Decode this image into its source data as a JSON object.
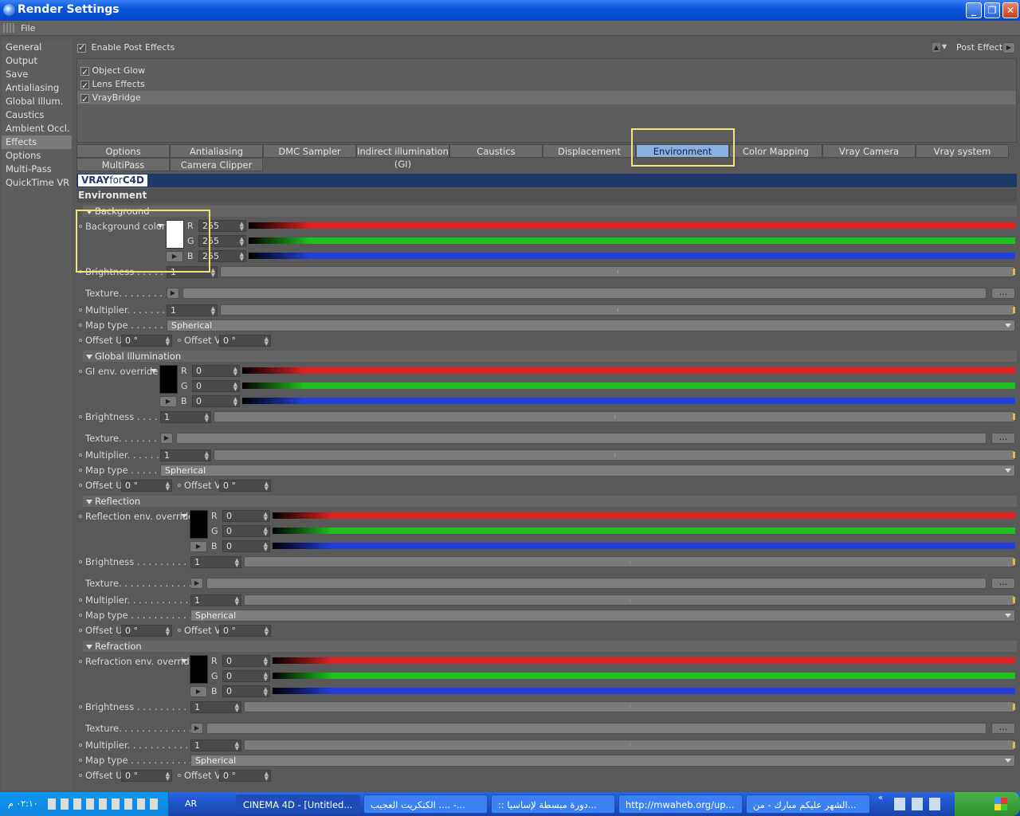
{
  "window": {
    "title": "Render Settings",
    "min": "_",
    "max": "❐",
    "close": "✕"
  },
  "menu": {
    "file": "File"
  },
  "sidebar": [
    {
      "label": "General",
      "active": false
    },
    {
      "label": "Output",
      "active": false
    },
    {
      "label": "Save",
      "active": false
    },
    {
      "label": "Antialiasing",
      "active": false
    },
    {
      "label": "Global Illum.",
      "active": false
    },
    {
      "label": "Caustics",
      "active": false
    },
    {
      "label": "Ambient Occl.",
      "active": false
    },
    {
      "label": "Effects",
      "active": true
    },
    {
      "label": "Options",
      "active": false
    },
    {
      "label": "Multi-Pass",
      "active": false
    },
    {
      "label": "QuickTime VR",
      "active": false
    }
  ],
  "effects": {
    "enable_label": "Enable Post Effects",
    "post_effect_label": "Post Effect",
    "items": [
      "Object Glow",
      "Lens Effects",
      "VrayBridge"
    ]
  },
  "tabs": {
    "row1": [
      "Options",
      "Antialiasing",
      "DMC Sampler",
      "Indirect illumination (GI)",
      "Caustics",
      "Displacement",
      "Environment",
      "Color Mapping",
      "Vray Camera",
      "Vray system"
    ],
    "row2": [
      "MultiPass",
      "Camera Clipper"
    ],
    "active": "Environment"
  },
  "logo": {
    "a": "VRAY",
    "b": "for",
    "c": "C4D"
  },
  "env_title": "Environment",
  "background": {
    "header": "Background",
    "color_label": "Background color",
    "r": "255",
    "g": "255",
    "b": "255",
    "brightness_label": "Brightness . . . . . . .",
    "brightness": "1",
    "texture_label": "Texture. . . . . . . . . .",
    "multiplier_label": "Multiplier. . . . . . . . .",
    "multiplier": "1",
    "maptype_label": "Map type . . . . . . . .",
    "maptype": "Spherical",
    "offsetu_label": "Offset U",
    "offsetu": "0 °",
    "offsetv_label": "Offset V",
    "offsetv": "0 °"
  },
  "gi": {
    "header": "Global Illumination",
    "color_label": "GI env. override",
    "r": "0",
    "g": "0",
    "b": "0",
    "brightness_label": "Brightness . . . . . .",
    "brightness": "1",
    "texture_label": "Texture. . . . . . . . .",
    "multiplier_label": "Multiplier. . . . . . . .",
    "multiplier": "1",
    "maptype_label": "Map type . . . . . . .",
    "maptype": "Spherical",
    "offsetu_label": "Offset U",
    "offsetu": "0 °",
    "offsetv_label": "Offset V",
    "offsetv": "0 °"
  },
  "reflection": {
    "header": "Reflection",
    "color_label": "Reflection env. override",
    "r": "0",
    "g": "0",
    "b": "0",
    "brightness_label": "Brightness . . . . . . . . . . . .",
    "brightness": "1",
    "texture_label": "Texture. . . . . . . . . . . . . . .",
    "multiplier_label": "Multiplier. . . . . . . . . . . . . .",
    "multiplier": "1",
    "maptype_label": "Map type . . . . . . . . . . . . .",
    "maptype": "Spherical",
    "offsetu_label": "Offset U",
    "offsetu": "0 °",
    "offsetv_label": "Offset V",
    "offsetv": "0 °"
  },
  "refraction": {
    "header": "Refraction",
    "color_label": "Refraction env. override",
    "r": "0",
    "g": "0",
    "b": "0",
    "brightness_label": "Brightness . . . . . . . . . . . .",
    "brightness": "1",
    "texture_label": "Texture. . . . . . . . . . . . . . .",
    "multiplier_label": "Multiplier. . . . . . . . . . . . . .",
    "multiplier": "1",
    "maptype_label": "Map type . . . . . . . . . . . . .",
    "maptype": "Spherical",
    "offsetu_label": "Offset U",
    "offsetu": "0 °",
    "offsetv_label": "Offset V",
    "offsetv": "0 °"
  },
  "channels": {
    "r": "R",
    "g": "G",
    "b": "B"
  },
  "taskbar": {
    "clock": "٠٢:١٠ م",
    "lang": "AR",
    "tasks": [
      "CINEMA 4D - [Untitled...",
      "الكنكريت العجيب .... -...",
      ":: دورة مبسطة لإساسيا...",
      "http://mwaheb.org/up...",
      "الشهر عليكم مبارك - من..."
    ]
  },
  "colors": {
    "accent": "#8ab0e0",
    "highlight": "#f2e37a",
    "red": "#e02020",
    "green": "#20c020",
    "blue": "#2040e0"
  }
}
